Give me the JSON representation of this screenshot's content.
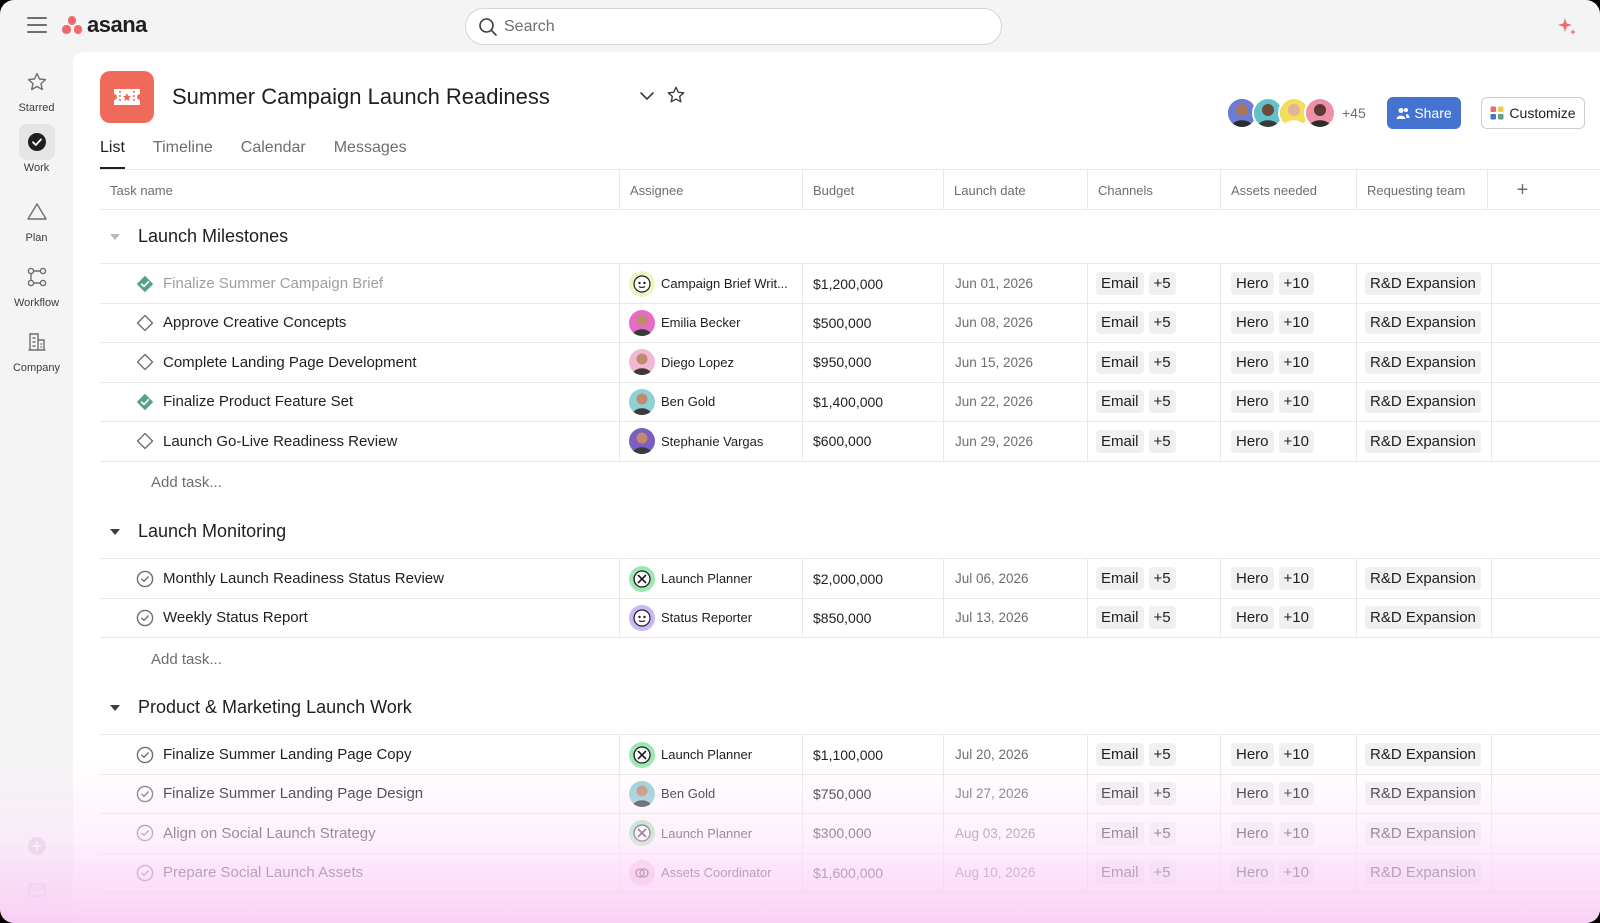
{
  "app": {
    "brand": "asana",
    "accent": "#f06a6a",
    "share_color": "#4573d2"
  },
  "search": {
    "placeholder": "Search"
  },
  "rail": [
    {
      "id": "starred",
      "label": "Starred",
      "icon": "star-icon"
    },
    {
      "id": "work",
      "label": "Work",
      "icon": "check-circle-icon"
    },
    {
      "id": "plan",
      "label": "Plan",
      "icon": "triangle-icon"
    },
    {
      "id": "workflow",
      "label": "Workflow",
      "icon": "workflow-icon"
    },
    {
      "id": "company",
      "label": "Company",
      "icon": "building-icon"
    }
  ],
  "project": {
    "title": "Summer Campaign Launch Readiness",
    "tabs": [
      "List",
      "Timeline",
      "Calendar",
      "Messages"
    ],
    "active_tab": "List",
    "member_count": "+45",
    "share_label": "Share",
    "customize_label": "Customize"
  },
  "columns": [
    "Task name",
    "Assignee",
    "Budget",
    "Launch date",
    "Channels",
    "Assets needed",
    "Requesting team"
  ],
  "add_column": "+",
  "add_task_label": "Add task...",
  "sections": [
    {
      "name": "Launch Milestones",
      "rows": [
        {
          "task": "Finalize Summer Campaign Brief",
          "status": "done",
          "assignee": "Campaign Brief Writ...",
          "budget": "$1,200,000",
          "date": "Jun 01, 2026",
          "channel": "Email",
          "channel_more": "+5",
          "asset": "Hero",
          "asset_more": "+10",
          "team": "R&D Expansion"
        },
        {
          "task": "Approve Creative Concepts",
          "status": "milestone",
          "assignee": "Emilia Becker",
          "budget": "$500,000",
          "date": "Jun 08, 2026",
          "channel": "Email",
          "channel_more": "+5",
          "asset": "Hero",
          "asset_more": "+10",
          "team": "R&D Expansion"
        },
        {
          "task": "Complete Landing Page Development",
          "status": "milestone",
          "assignee": "Diego Lopez",
          "budget": "$950,000",
          "date": "Jun 15, 2026",
          "channel": "Email",
          "channel_more": "+5",
          "asset": "Hero",
          "asset_more": "+10",
          "team": "R&D Expansion"
        },
        {
          "task": "Finalize Product Feature Set",
          "status": "done-milestone",
          "assignee": "Ben Gold",
          "budget": "$1,400,000",
          "date": "Jun 22, 2026",
          "channel": "Email",
          "channel_more": "+5",
          "asset": "Hero",
          "asset_more": "+10",
          "team": "R&D Expansion"
        },
        {
          "task": "Launch Go-Live Readiness Review",
          "status": "milestone",
          "assignee": "Stephanie Vargas",
          "budget": "$600,000",
          "date": "Jun 29, 2026",
          "channel": "Email",
          "channel_more": "+5",
          "asset": "Hero",
          "asset_more": "+10",
          "team": "R&D Expansion"
        }
      ]
    },
    {
      "name": "Launch Monitoring",
      "rows": [
        {
          "task": "Monthly Launch Readiness Status Review",
          "status": "open",
          "assignee": "Launch Planner",
          "budget": "$2,000,000",
          "date": "Jul 06, 2026",
          "channel": "Email",
          "channel_more": "+5",
          "asset": "Hero",
          "asset_more": "+10",
          "team": "R&D Expansion"
        },
        {
          "task": "Weekly Status Report",
          "status": "open",
          "assignee": "Status Reporter",
          "budget": "$850,000",
          "date": "Jul 13, 2026",
          "channel": "Email",
          "channel_more": "+5",
          "asset": "Hero",
          "asset_more": "+10",
          "team": "R&D Expansion"
        }
      ]
    },
    {
      "name": "Product & Marketing Launch Work",
      "rows": [
        {
          "task": "Finalize Summer Landing Page Copy",
          "status": "open",
          "assignee": "Launch Planner",
          "budget": "$1,100,000",
          "date": "Jul 20, 2026",
          "channel": "Email",
          "channel_more": "+5",
          "asset": "Hero",
          "asset_more": "+10",
          "team": "R&D Expansion"
        },
        {
          "task": "Finalize Summer Landing Page Design",
          "status": "open",
          "assignee": "Ben Gold",
          "budget": "$750,000",
          "date": "Jul 27, 2026",
          "channel": "Email",
          "channel_more": "+5",
          "asset": "Hero",
          "asset_more": "+10",
          "team": "R&D Expansion"
        },
        {
          "task": "Align on Social Launch Strategy",
          "status": "open",
          "assignee": "Launch Planner",
          "budget": "$300,000",
          "date": "Aug 03, 2026",
          "channel": "Email",
          "channel_more": "+5",
          "asset": "Hero",
          "asset_more": "+10",
          "team": "R&D Expansion"
        },
        {
          "task": "Prepare Social Launch Assets",
          "status": "open",
          "assignee": "Assets Coordinator",
          "budget": "$1,600,000",
          "date": "Aug 10, 2026",
          "channel": "Email",
          "channel_more": "+5",
          "asset": "Hero",
          "asset_more": "+10",
          "team": "R&D Expansion"
        }
      ]
    }
  ]
}
